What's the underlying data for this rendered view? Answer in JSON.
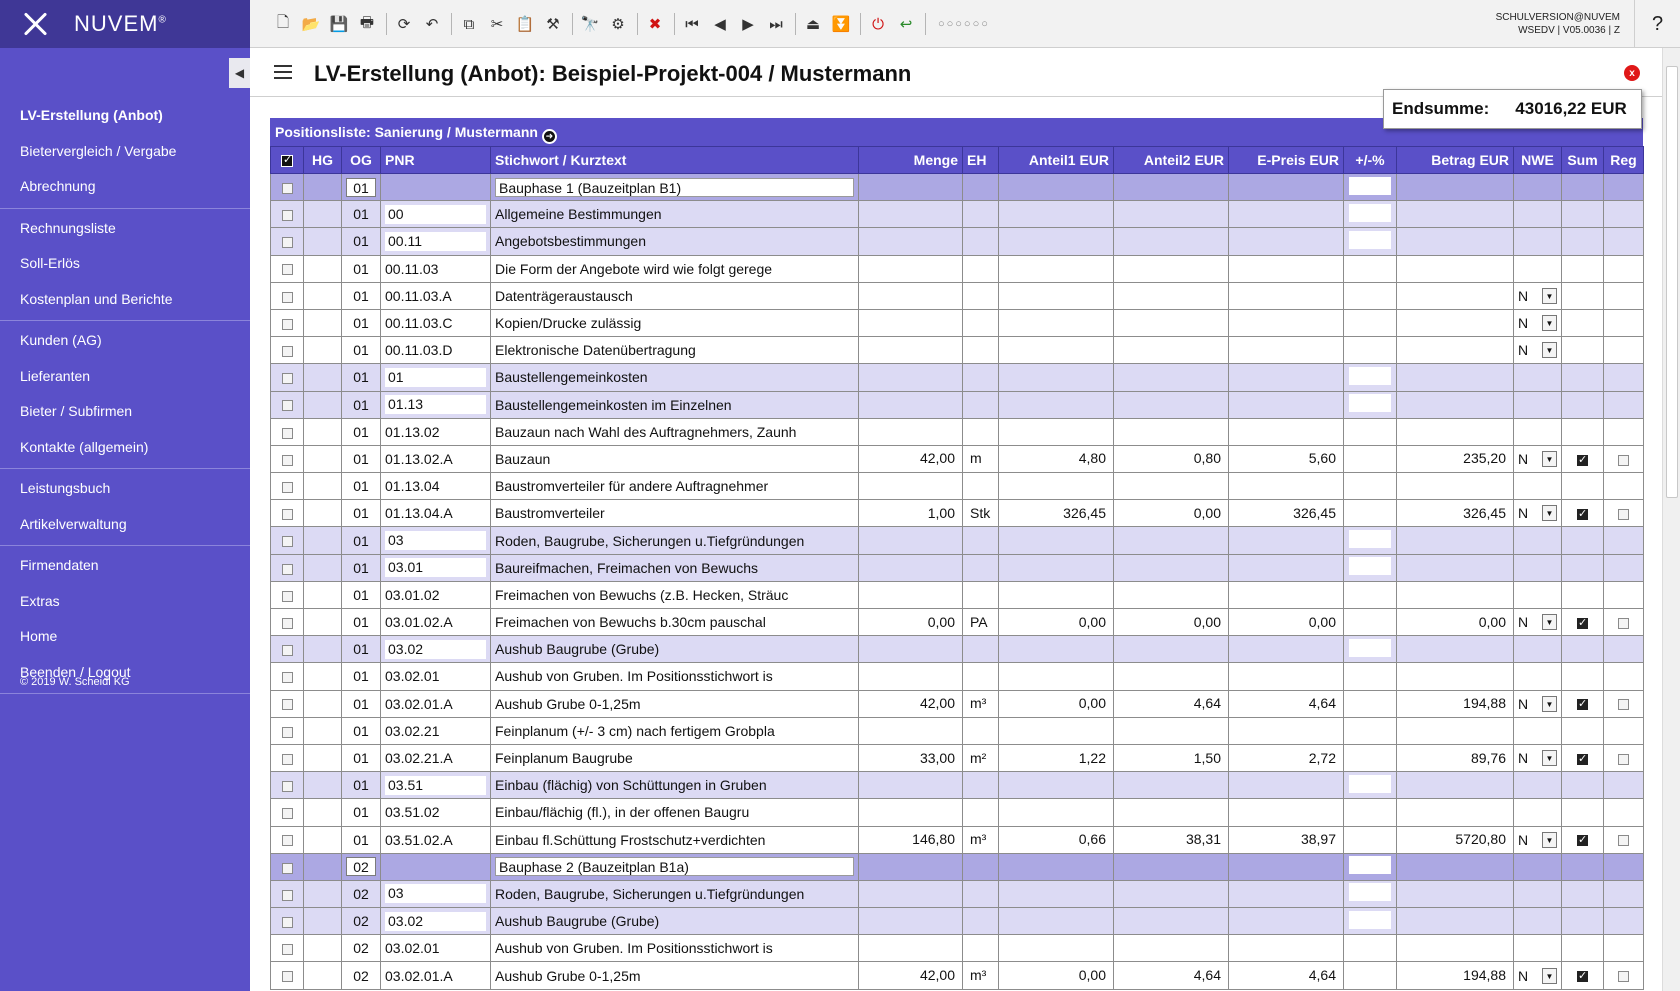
{
  "brand": {
    "name": "NUVEM",
    "mark": "®"
  },
  "sidebar": {
    "groups": [
      [
        {
          "label": "LV-Erstellung (Anbot)",
          "active": true
        },
        {
          "label": "Bietervergleich / Vergabe"
        },
        {
          "label": "Abrechnung"
        }
      ],
      [
        {
          "label": "Rechnungsliste"
        },
        {
          "label": "Soll-Erlös"
        },
        {
          "label": "Kostenplan und Berichte"
        }
      ],
      [
        {
          "label": "Kunden (AG)"
        },
        {
          "label": "Lieferanten"
        },
        {
          "label": "Bieter / Subfirmen"
        },
        {
          "label": "Kontakte (allgemein)"
        }
      ],
      [
        {
          "label": "Leistungsbuch"
        },
        {
          "label": "Artikelverwaltung"
        }
      ],
      [
        {
          "label": "Firmendaten"
        },
        {
          "label": "Extras"
        },
        {
          "label": "Home"
        },
        {
          "label": "Beenden / Logout"
        }
      ]
    ],
    "copyright": "© 2019 W. Scheidl KG"
  },
  "toolbar": {
    "version_line1": "SCHULVERSION@NUVEM",
    "version_line2": "WSEDV | V05.0036 | Z",
    "help": "?"
  },
  "header": {
    "title": "LV-Erstellung (Anbot): Beispiel-Projekt-004 / Mustermann",
    "close": "x"
  },
  "endsumme": {
    "label": "Endsumme:",
    "value": "43016,22 EUR"
  },
  "list": {
    "caption": "Positionsliste: Sanierung / Mustermann",
    "columns": [
      "HG",
      "OG",
      "PNR",
      "Stichwort / Kurztext",
      "Menge",
      "EH",
      "Anteil1 EUR",
      "Anteil2 EUR",
      "E-Preis EUR",
      "+/-%",
      "Betrag EUR",
      "NWE",
      "Sum",
      "Reg"
    ],
    "rows": [
      {
        "type": "phase",
        "og": "01",
        "pnr": "",
        "text": "Bauphase 1 (Bauzeitplan B1)",
        "pct": true
      },
      {
        "type": "group",
        "og": "01",
        "pnr": "00",
        "text": "Allgemeine Bestimmungen",
        "pct": true
      },
      {
        "type": "group",
        "og": "01",
        "pnr": "00.11",
        "text": "Angebotsbestimmungen",
        "pct": true
      },
      {
        "type": "item",
        "og": "01",
        "pnr": "00.11.03",
        "text": "Die Form der Angebote wird wie folgt gerege"
      },
      {
        "type": "item",
        "og": "01",
        "pnr": "00.11.03.A",
        "text": "Datenträgeraustausch",
        "nwe": "N"
      },
      {
        "type": "item",
        "og": "01",
        "pnr": "00.11.03.C",
        "text": "Kopien/Drucke zulässig",
        "nwe": "N"
      },
      {
        "type": "item",
        "og": "01",
        "pnr": "00.11.03.D",
        "text": "Elektronische Datenübertragung",
        "nwe": "N"
      },
      {
        "type": "group",
        "og": "01",
        "pnr": "01",
        "text": "Baustellengemeinkosten",
        "pct": true
      },
      {
        "type": "group",
        "og": "01",
        "pnr": "01.13",
        "text": "Baustellengemeinkosten im Einzelnen",
        "pct": true
      },
      {
        "type": "item",
        "og": "01",
        "pnr": "01.13.02",
        "text": "Bauzaun nach Wahl des Auftragnehmers, Zaunh"
      },
      {
        "type": "item",
        "og": "01",
        "pnr": "01.13.02.A",
        "text": "Bauzaun",
        "menge": "42,00",
        "eh": "m",
        "a1": "4,80",
        "a2": "0,80",
        "ep": "5,60",
        "betrag": "235,20",
        "nwe": "N",
        "sum": true
      },
      {
        "type": "item",
        "og": "01",
        "pnr": "01.13.04",
        "text": "Baustromverteiler für andere Auftragnehmer"
      },
      {
        "type": "item",
        "og": "01",
        "pnr": "01.13.04.A",
        "text": "Baustromverteiler",
        "menge": "1,00",
        "eh": "Stk",
        "a1": "326,45",
        "a2": "0,00",
        "ep": "326,45",
        "betrag": "326,45",
        "nwe": "N",
        "sum": true
      },
      {
        "type": "group",
        "og": "01",
        "pnr": "03",
        "text": "Roden, Baugrube, Sicherungen u.Tiefgründungen",
        "pct": true
      },
      {
        "type": "group",
        "og": "01",
        "pnr": "03.01",
        "text": "Baureifmachen, Freimachen von Bewuchs",
        "pct": true
      },
      {
        "type": "item",
        "og": "01",
        "pnr": "03.01.02",
        "text": "Freimachen von Bewuchs (z.B. Hecken, Sträuc"
      },
      {
        "type": "item",
        "og": "01",
        "pnr": "03.01.02.A",
        "text": "Freimachen von Bewuchs b.30cm pauschal",
        "menge": "0,00",
        "eh": "PA",
        "a1": "0,00",
        "a2": "0,00",
        "ep": "0,00",
        "betrag": "0,00",
        "nwe": "N",
        "sum": true
      },
      {
        "type": "group",
        "og": "01",
        "pnr": "03.02",
        "text": "Aushub Baugrube (Grube)",
        "pct": true
      },
      {
        "type": "item",
        "og": "01",
        "pnr": "03.02.01",
        "text": "Aushub von Gruben. Im Positionsstichwort is"
      },
      {
        "type": "item",
        "og": "01",
        "pnr": "03.02.01.A",
        "text": "Aushub Grube 0-1,25m",
        "menge": "42,00",
        "eh": "m³",
        "a1": "0,00",
        "a2": "4,64",
        "ep": "4,64",
        "betrag": "194,88",
        "nwe": "N",
        "sum": true
      },
      {
        "type": "item",
        "og": "01",
        "pnr": "03.02.21",
        "text": "Feinplanum (+/- 3 cm) nach fertigem Grobpla"
      },
      {
        "type": "item",
        "og": "01",
        "pnr": "03.02.21.A",
        "text": "Feinplanum Baugrube",
        "menge": "33,00",
        "eh": "m²",
        "a1": "1,22",
        "a2": "1,50",
        "ep": "2,72",
        "betrag": "89,76",
        "nwe": "N",
        "sum": true
      },
      {
        "type": "group",
        "og": "01",
        "pnr": "03.51",
        "text": "Einbau (flächig) von Schüttungen in Gruben",
        "pct": true
      },
      {
        "type": "item",
        "og": "01",
        "pnr": "03.51.02",
        "text": "Einbau/flächig (fl.), in der offenen Baugru"
      },
      {
        "type": "item",
        "og": "01",
        "pnr": "03.51.02.A",
        "text": "Einbau fl.Schüttung Frostschutz+verdichten",
        "menge": "146,80",
        "eh": "m³",
        "a1": "0,66",
        "a2": "38,31",
        "ep": "38,97",
        "betrag": "5720,80",
        "nwe": "N",
        "sum": true
      },
      {
        "type": "phase",
        "og": "02",
        "pnr": "",
        "text": "Bauphase 2 (Bauzeitplan B1a)",
        "pct": true
      },
      {
        "type": "group",
        "og": "02",
        "pnr": "03",
        "text": "Roden, Baugrube, Sicherungen u.Tiefgründungen",
        "pct": true
      },
      {
        "type": "group",
        "og": "02",
        "pnr": "03.02",
        "text": "Aushub Baugrube (Grube)",
        "pct": true
      },
      {
        "type": "item",
        "og": "02",
        "pnr": "03.02.01",
        "text": "Aushub von Gruben. Im Positionsstichwort is"
      },
      {
        "type": "item",
        "og": "02",
        "pnr": "03.02.01.A",
        "text": "Aushub Grube 0-1,25m",
        "menge": "42,00",
        "eh": "m³",
        "a1": "0,00",
        "a2": "4,64",
        "ep": "4,64",
        "betrag": "194,88",
        "nwe": "N",
        "sum": true
      }
    ]
  }
}
